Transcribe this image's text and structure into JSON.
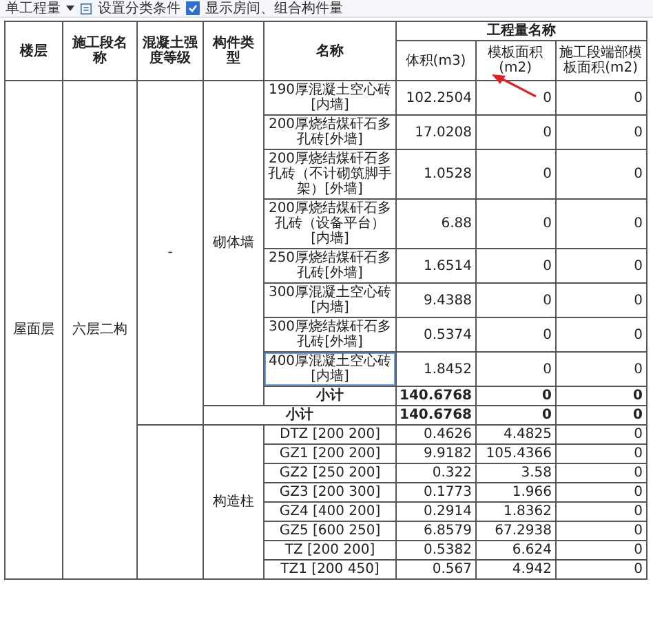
{
  "toolbar": [
    {
      "kind": "dropdown",
      "label": "单工程量"
    },
    {
      "kind": "button",
      "label": "设置分类条件"
    },
    {
      "kind": "checkbox",
      "label": "显示房间、组合构件量",
      "checked": true
    }
  ],
  "table": {
    "columns": [
      "楼层",
      "施工段名称",
      "混凝土强度等级",
      "构件类型",
      "名称"
    ],
    "group_header": "工程量名称",
    "quantity_columns": [
      "体积(m3)",
      "模板面积(m2)",
      "施工段端部模板面积(m2)"
    ],
    "floor": "屋面层",
    "segment": "六层二构",
    "grades": [
      {
        "grade": "-",
        "types": [
          {
            "type": "砌体墙",
            "rows": [
              {
                "name": "190厚混凝土空心砖[内墙]",
                "values": [
                  "102.2504",
                  "0",
                  "0"
                ],
                "selected": false
              },
              {
                "name": "200厚烧结煤矸石多孔砖[外墙]",
                "values": [
                  "17.0208",
                  "0",
                  "0"
                ],
                "selected": false
              },
              {
                "name": "200厚烧结煤矸石多孔砖（不计砌筑脚手架）[外墙]",
                "values": [
                  "1.0528",
                  "0",
                  "0"
                ],
                "selected": false
              },
              {
                "name": "200厚烧结煤矸石多孔砖（设备平台）[内墙]",
                "values": [
                  "6.88",
                  "0",
                  "0"
                ],
                "selected": false
              },
              {
                "name": "250厚烧结煤矸石多孔砖[外墙]",
                "values": [
                  "1.6514",
                  "0",
                  "0"
                ],
                "selected": false
              },
              {
                "name": "300厚混凝土空心砖[内墙]",
                "values": [
                  "9.4388",
                  "0",
                  "0"
                ],
                "selected": false
              },
              {
                "name": "300厚烧结煤矸石多孔砖[外墙]",
                "values": [
                  "0.5374",
                  "0",
                  "0"
                ],
                "selected": false
              },
              {
                "name": "400厚混凝土空心砖[内墙]",
                "values": [
                  "1.8452",
                  "0",
                  "0"
                ],
                "selected": true
              }
            ],
            "subtotal": {
              "label": "小计",
              "values": [
                "140.6768",
                "0",
                "0"
              ]
            }
          }
        ],
        "total": {
          "label": "小计",
          "values": [
            "140.6768",
            "0",
            "0"
          ]
        }
      },
      {
        "types": [
          {
            "type": "构造柱",
            "rows": [
              {
                "name": "DTZ [200 200]",
                "values": [
                  "0.4626",
                  "4.4825",
                  "0"
                ],
                "selected": false
              },
              {
                "name": "GZ1 [200 200]",
                "values": [
                  "9.9182",
                  "105.4366",
                  "0"
                ],
                "selected": false
              },
              {
                "name": "GZ2 [250 200]",
                "values": [
                  "0.322",
                  "3.58",
                  "0"
                ],
                "selected": false
              },
              {
                "name": "GZ3 [200 300]",
                "values": [
                  "0.1773",
                  "1.966",
                  "0"
                ],
                "selected": false
              },
              {
                "name": "GZ4 [400 200]",
                "values": [
                  "0.2914",
                  "1.8362",
                  "0"
                ],
                "selected": false
              },
              {
                "name": "GZ5 [600 250]",
                "values": [
                  "6.8579",
                  "67.2938",
                  "0"
                ],
                "selected": false
              },
              {
                "name": "TZ [200 200]",
                "values": [
                  "0.5382",
                  "6.624",
                  "0"
                ],
                "selected": false
              },
              {
                "name": "TZ1 [200 450]",
                "values": [
                  "0.567",
                  "4.942",
                  "0"
                ],
                "selected": false
              }
            ]
          }
        ]
      }
    ]
  }
}
